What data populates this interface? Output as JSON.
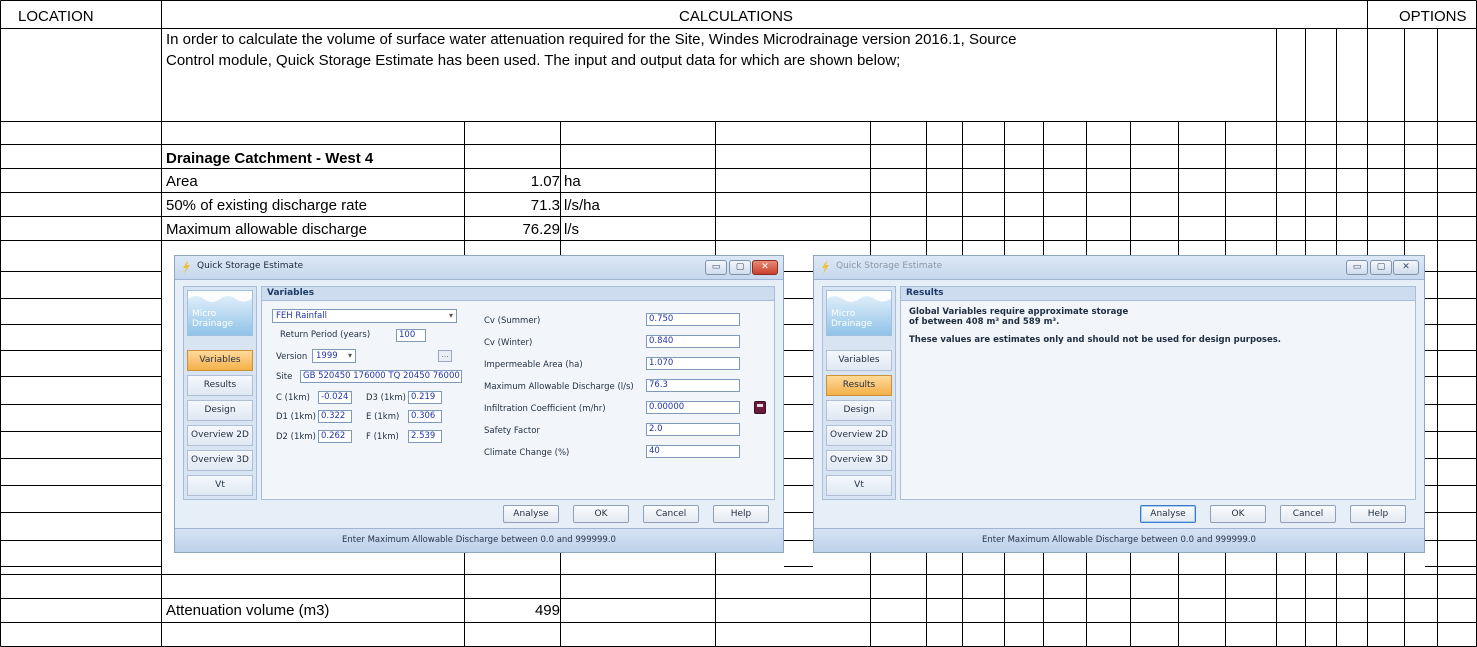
{
  "headers": {
    "location": "LOCATION",
    "calculations": "CALCULATIONS",
    "options": "OPTIONS"
  },
  "intro": {
    "line1": "In order to calculate the volume of surface water attenuation required for the Site, Windes Microdrainage version 2016.1, Source",
    "line2": "Control module, Quick Storage Estimate has been used. The input and output data for which are shown below;"
  },
  "catchment": {
    "heading": "Drainage Catchment - West 4",
    "rows": [
      {
        "label": "Area",
        "value": "1.07",
        "unit": "ha"
      },
      {
        "label": "50% of existing discharge rate",
        "value": "71.3",
        "unit": "l/s/ha"
      },
      {
        "label": "Maximum allowable discharge",
        "value": "76.29",
        "unit": "l/s"
      }
    ]
  },
  "result": {
    "label": "Attenuation volume (m3)",
    "value": "499"
  },
  "dialog_left": {
    "title": "Quick Storage Estimate",
    "panel_title": "Variables",
    "rainfall_select": "FEH Rainfall",
    "return_period_label": "Return Period (years)",
    "return_period_value": "100",
    "version_label": "Version",
    "version_value": "1999",
    "site_label": "Site",
    "site_value": "GB 520450 176000 TQ 20450 76000",
    "c1km_label": "C (1km)",
    "c1km_value": "-0.024",
    "d1_label": "D1 (1km)",
    "d1_value": "0.322",
    "d2_label": "D2 (1km)",
    "d2_value": "0.262",
    "d3_label": "D3 (1km)",
    "d3_value": "0.219",
    "e_label": "E (1km)",
    "e_value": "0.306",
    "f_label": "F (1km)",
    "f_value": "2.539",
    "cv_summer_label": "Cv (Summer)",
    "cv_summer_value": "0.750",
    "cv_winter_label": "Cv (Winter)",
    "cv_winter_value": "0.840",
    "imp_area_label": "Impermeable Area (ha)",
    "imp_area_value": "1.070",
    "max_discharge_label": "Maximum Allowable Discharge (l/s)",
    "max_discharge_value": "76.3",
    "infiltration_label": "Infiltration Coefficient (m/hr)",
    "infiltration_value": "0.00000",
    "safety_label": "Safety Factor",
    "safety_value": "2.0",
    "climate_label": "Climate Change (%)",
    "climate_value": "40",
    "status": "Enter Maximum Allowable Discharge between 0.0 and 999999.0"
  },
  "dialog_right": {
    "title": "Quick Storage Estimate",
    "panel_title": "Results",
    "result_line1": "Global Variables require approximate storage",
    "result_line2": "of between 408 m³ and 589 m³.",
    "note": "These values are estimates only and should not be used for design purposes.",
    "status": "Enter Maximum Allowable Discharge between 0.0 and 999999.0"
  },
  "nav": [
    "Variables",
    "Results",
    "Design",
    "Overview 2D",
    "Overview 3D",
    "Vt"
  ],
  "brand": {
    "line1": "Micro",
    "line2": "Drainage"
  },
  "buttons": {
    "analyse": "Analyse",
    "ok": "OK",
    "cancel": "Cancel",
    "help": "Help"
  },
  "window_controls": {
    "minimize": "▭",
    "restore": "▢",
    "close": "✕"
  },
  "colors": {
    "active_tab": "#f4b04a",
    "input_text": "#2234a8",
    "dialog_bg": "#e6eef8"
  }
}
